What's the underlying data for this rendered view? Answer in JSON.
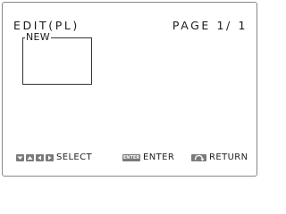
{
  "header": {
    "title": "EDIT(PL)",
    "page": "PAGE 1/ 1"
  },
  "list": {
    "items": [
      {
        "label": "NEW"
      }
    ]
  },
  "footer": {
    "select_label": "SELECT",
    "enter_key_label": "ENTER",
    "enter_label": "ENTER",
    "return_label": "RETURN"
  },
  "colors": {
    "key_fill": "#7a7a7a",
    "text": "#1a1a1a",
    "border": "#888888"
  },
  "icons": {
    "nav": [
      "arrow-down-icon",
      "arrow-up-icon",
      "arrow-left-icon",
      "arrow-right-icon"
    ],
    "enter": "enter-key-icon",
    "return": "return-key-icon"
  }
}
